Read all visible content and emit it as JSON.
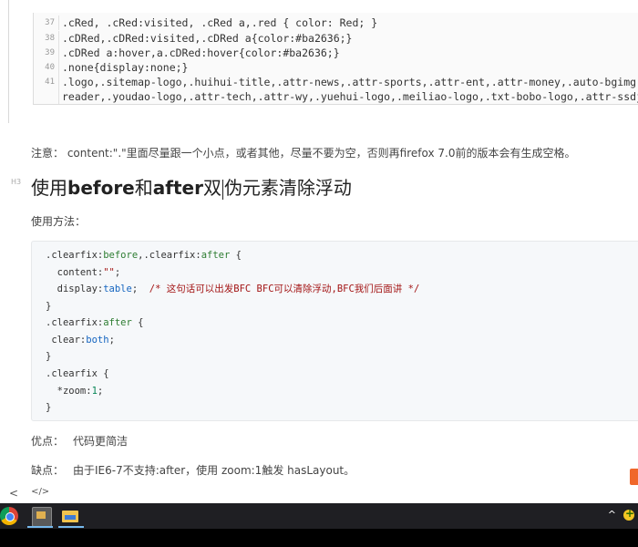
{
  "code_top": {
    "lines": [
      {
        "num": "37",
        "text": ".cRed, .cRed:visited, .cRed a,.red { color: Red; }"
      },
      {
        "num": "38",
        "text": ".cDRed,.cDRed:visited,.cDRed a{color:#ba2636;}"
      },
      {
        "num": "39",
        "text": ".cDRed a:hover,a.cDRed:hover{color:#ba2636;}"
      },
      {
        "num": "40",
        "text": ".none{display:none;}"
      },
      {
        "num": "41",
        "text": ".logo,.sitemap-logo,.huihui-title,.attr-news,.attr-sports,.attr-ent,.attr-money,.auto-bgimg,"
      },
      {
        "num": "",
        "text": "reader,.youdao-logo,.attr-tech,.attr-wy,.yuehui-logo,.meiliao-logo,.txt-bobo-logo,.attr-ssdj"
      }
    ]
  },
  "note": "注意： content:\".\"里面尽量跟一个小点，或者其他，尽量不要为空，否则再firefox 7.0前的版本会有生成空格。",
  "heading_anchor": "H3",
  "heading": {
    "p1": "使用",
    "b1": "before",
    "p2": "和",
    "b2": "after",
    "p3": "双",
    "p4": "伪元素清除浮动"
  },
  "usage_label": "使用方法：",
  "code_main": {
    "l1_sel": ".clearfix:",
    "l1_kw1": "before",
    "l1_mid": ",.clearfix:",
    "l1_kw2": "after",
    "l1_end": " {",
    "l2_prop": "  content:",
    "l2_val": "\"\"",
    "l2_end": ";",
    "l3_prop": "  display:",
    "l3_val": "table",
    "l3_end": ";  ",
    "l3_comment": "/* 这句话可以出发BFC BFC可以清除浮动,BFC我们后面讲 */",
    "l4": "}",
    "l5_sel": ".clearfix:",
    "l5_kw": "after",
    "l5_end": " {",
    "l6_prop": " clear:",
    "l6_val": "both",
    "l6_end": ";",
    "l7": "}",
    "l8": ".clearfix {",
    "l9_prop": "  *zoom:",
    "l9_val": "1",
    "l9_end": ";",
    "l10": "}"
  },
  "pros": {
    "label": "优点：",
    "text": "代码更简洁"
  },
  "cons": {
    "label": "缺点：",
    "text": "由于IE6-7不支持:after，使用 zoom:1触发 hasLayout。"
  },
  "bottom_tools": {
    "collapse": "<",
    "code": "</>"
  },
  "colors": {
    "taskbar": "#1f1f23",
    "code_bg": "#f6f8fa",
    "keyword": "#2e7d32",
    "value": "#1565c0",
    "comment": "#a31515"
  },
  "taskbar_icons": [
    "chrome-icon",
    "terminal-app-icon",
    "file-explorer-icon"
  ],
  "tray": {
    "chevron": "^"
  }
}
